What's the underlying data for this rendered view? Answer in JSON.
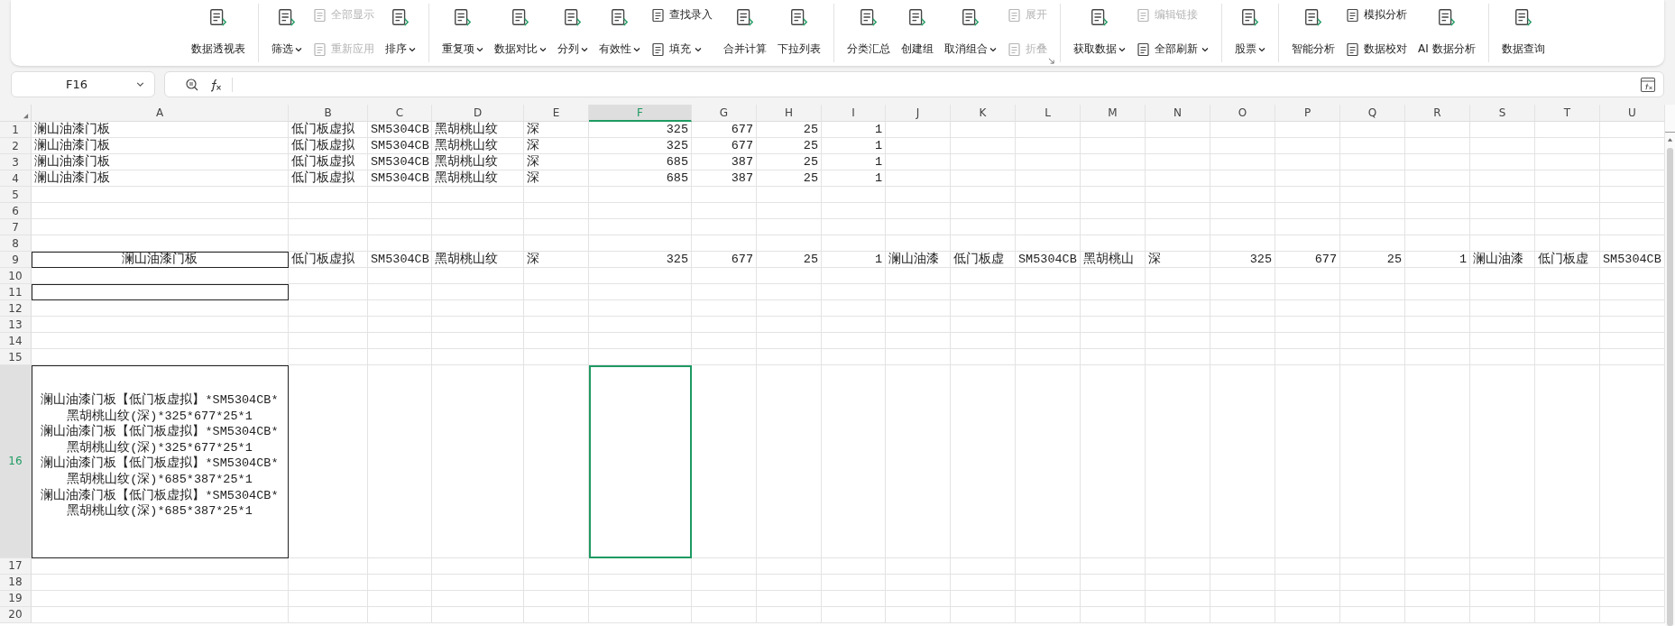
{
  "toolbar": {
    "sections": [
      {
        "items": [
          {
            "kind": "large",
            "label": "数据透视表",
            "menu": false,
            "disabled": false
          }
        ]
      },
      {
        "items": [
          {
            "kind": "large",
            "label": "筛选",
            "menu": true,
            "disabled": false
          },
          {
            "kind": "stack",
            "items": [
              {
                "label": "全部显示",
                "menu": false,
                "disabled": true
              },
              {
                "label": "重新应用",
                "menu": false,
                "disabled": true
              }
            ]
          },
          {
            "kind": "large",
            "label": "排序",
            "menu": true,
            "disabled": false
          }
        ]
      },
      {
        "items": [
          {
            "kind": "large",
            "label": "重复项",
            "menu": true,
            "disabled": false
          },
          {
            "kind": "large",
            "label": "数据对比",
            "menu": true,
            "disabled": false
          },
          {
            "kind": "large",
            "label": "分列",
            "menu": true,
            "disabled": false
          },
          {
            "kind": "large",
            "label": "有效性",
            "menu": true,
            "disabled": false
          },
          {
            "kind": "stack",
            "items": [
              {
                "label": "查找录入",
                "menu": false,
                "disabled": false
              },
              {
                "label": "填充",
                "menu": true,
                "disabled": false
              }
            ]
          },
          {
            "kind": "large",
            "label": "合并计算",
            "menu": false,
            "disabled": false
          },
          {
            "kind": "large",
            "label": "下拉列表",
            "menu": false,
            "disabled": false
          }
        ]
      },
      {
        "launcher": true,
        "items": [
          {
            "kind": "large",
            "label": "分类汇总",
            "menu": false,
            "disabled": false
          },
          {
            "kind": "large",
            "label": "创建组",
            "menu": false,
            "disabled": false
          },
          {
            "kind": "large",
            "label": "取消组合",
            "menu": true,
            "disabled": false
          },
          {
            "kind": "stack",
            "items": [
              {
                "label": "展开",
                "menu": false,
                "disabled": true
              },
              {
                "label": "折叠",
                "menu": false,
                "disabled": true
              }
            ]
          }
        ]
      },
      {
        "items": [
          {
            "kind": "large",
            "label": "获取数据",
            "menu": true,
            "disabled": false
          },
          {
            "kind": "stack",
            "items": [
              {
                "label": "编辑链接",
                "menu": false,
                "disabled": true
              },
              {
                "label": "全部刷新",
                "menu": true,
                "disabled": false
              }
            ]
          }
        ]
      },
      {
        "items": [
          {
            "kind": "large",
            "label": "股票",
            "menu": true,
            "disabled": false
          }
        ]
      },
      {
        "items": [
          {
            "kind": "large",
            "label": "智能分析",
            "menu": false,
            "disabled": false
          },
          {
            "kind": "stack",
            "items": [
              {
                "label": "模拟分析",
                "menu": false,
                "disabled": false
              },
              {
                "label": "数据校对",
                "menu": false,
                "disabled": false
              }
            ]
          },
          {
            "kind": "large",
            "label": "AI 数据分析",
            "menu": false,
            "disabled": false
          }
        ]
      },
      {
        "items": [
          {
            "kind": "large",
            "label": "数据查询",
            "menu": false,
            "disabled": false
          }
        ]
      }
    ]
  },
  "formula_bar": {
    "cell_name": "F16"
  },
  "sheet": {
    "columns": [
      {
        "label": "A",
        "selected": false
      },
      {
        "label": "B",
        "selected": false
      },
      {
        "label": "C",
        "selected": false
      },
      {
        "label": "D",
        "selected": false
      },
      {
        "label": "E",
        "selected": false
      },
      {
        "label": "F",
        "selected": true
      },
      {
        "label": "G",
        "selected": false
      },
      {
        "label": "H",
        "selected": false
      },
      {
        "label": "I",
        "selected": false
      },
      {
        "label": "J",
        "selected": false
      },
      {
        "label": "K",
        "selected": false
      },
      {
        "label": "L",
        "selected": false
      },
      {
        "label": "M",
        "selected": false
      },
      {
        "label": "N",
        "selected": false
      },
      {
        "label": "O",
        "selected": false
      },
      {
        "label": "P",
        "selected": false
      },
      {
        "label": "Q",
        "selected": false
      },
      {
        "label": "R",
        "selected": false
      },
      {
        "label": "S",
        "selected": false
      },
      {
        "label": "T",
        "selected": false
      },
      {
        "label": "U",
        "selected": false
      }
    ],
    "rows": [
      {
        "number": "1",
        "selected": false,
        "cells": [
          {
            "text": "澜山油漆门板"
          },
          {
            "text": "低门板虚拟"
          },
          {
            "text": "SM5304CB"
          },
          {
            "text": "黑胡桃山纹"
          },
          {
            "text": "深"
          },
          {
            "text": "325",
            "right_aligned": true
          },
          {
            "text": "677",
            "right_aligned": true
          },
          {
            "text": "25",
            "right_aligned": true
          },
          {
            "text": "1",
            "right_aligned": true
          }
        ]
      },
      {
        "number": "2",
        "selected": false,
        "cells": [
          {
            "text": "澜山油漆门板"
          },
          {
            "text": "低门板虚拟"
          },
          {
            "text": "SM5304CB"
          },
          {
            "text": "黑胡桃山纹"
          },
          {
            "text": "深"
          },
          {
            "text": "325",
            "right_aligned": true
          },
          {
            "text": "677",
            "right_aligned": true
          },
          {
            "text": "25",
            "right_aligned": true
          },
          {
            "text": "1",
            "right_aligned": true
          }
        ]
      },
      {
        "number": "3",
        "selected": false,
        "cells": [
          {
            "text": "澜山油漆门板"
          },
          {
            "text": "低门板虚拟"
          },
          {
            "text": "SM5304CB"
          },
          {
            "text": "黑胡桃山纹"
          },
          {
            "text": "深"
          },
          {
            "text": "685",
            "right_aligned": true
          },
          {
            "text": "387",
            "right_aligned": true
          },
          {
            "text": "25",
            "right_aligned": true
          },
          {
            "text": "1",
            "right_aligned": true
          }
        ]
      },
      {
        "number": "4",
        "selected": false,
        "cells": [
          {
            "text": "澜山油漆门板"
          },
          {
            "text": "低门板虚拟"
          },
          {
            "text": "SM5304CB"
          },
          {
            "text": "黑胡桃山纹"
          },
          {
            "text": "深"
          },
          {
            "text": "685",
            "right_aligned": true
          },
          {
            "text": "387",
            "right_aligned": true
          },
          {
            "text": "25",
            "right_aligned": true
          },
          {
            "text": "1",
            "right_aligned": true
          }
        ]
      },
      {
        "number": "5",
        "selected": false,
        "cells": []
      },
      {
        "number": "6",
        "selected": false,
        "cells": []
      },
      {
        "number": "7",
        "selected": false,
        "cells": []
      },
      {
        "number": "8",
        "selected": false,
        "cells": []
      },
      {
        "number": "9",
        "selected": false,
        "cells": [
          {
            "text": "澜山油漆门板",
            "centered": true,
            "bordered": true
          },
          {
            "text": "低门板虚拟"
          },
          {
            "text": "SM5304CB"
          },
          {
            "text": "黑胡桃山纹"
          },
          {
            "text": "深"
          },
          {
            "text": "325",
            "right_aligned": true
          },
          {
            "text": "677",
            "right_aligned": true
          },
          {
            "text": "25",
            "right_aligned": true
          },
          {
            "text": "1",
            "right_aligned": true
          },
          {
            "text": "澜山油漆"
          },
          {
            "text": "低门板虚"
          },
          {
            "text": "SM5304CB"
          },
          {
            "text": "黑胡桃山"
          },
          {
            "text": "深"
          },
          {
            "text": "325",
            "right_aligned": true
          },
          {
            "text": "677",
            "right_aligned": true
          },
          {
            "text": "25",
            "right_aligned": true
          },
          {
            "text": "1",
            "right_aligned": true
          },
          {
            "text": "澜山油漆"
          },
          {
            "text": "低门板虚"
          },
          {
            "text": "SM5304CB"
          }
        ]
      },
      {
        "number": "10",
        "selected": false,
        "cells": []
      },
      {
        "number": "11",
        "selected": false,
        "cells": [
          {
            "bordered": true
          }
        ]
      },
      {
        "number": "12",
        "selected": false,
        "cells": []
      },
      {
        "number": "13",
        "selected": false,
        "cells": []
      },
      {
        "number": "14",
        "selected": false,
        "cells": []
      },
      {
        "number": "15",
        "selected": false,
        "cells": []
      },
      {
        "number": "16",
        "selected": true,
        "cells": [
          {
            "text": "澜山油漆门板【低门板虚拟】*SM5304CB*\n黑胡桃山纹(深)*325*677*25*1\n澜山油漆门板【低门板虚拟】*SM5304CB*\n黑胡桃山纹(深)*325*677*25*1\n澜山油漆门板【低门板虚拟】*SM5304CB*\n黑胡桃山纹(深)*685*387*25*1\n澜山油漆门板【低门板虚拟】*SM5304CB*\n黑胡桃山纹(深)*685*387*25*1",
            "centered": true,
            "bordered": true,
            "wrap": true
          }
        ]
      },
      {
        "number": "17",
        "selected": false,
        "cells": []
      },
      {
        "number": "18",
        "selected": false,
        "cells": []
      },
      {
        "number": "19",
        "selected": false,
        "cells": []
      },
      {
        "number": "20",
        "selected": false,
        "cells": []
      }
    ]
  }
}
